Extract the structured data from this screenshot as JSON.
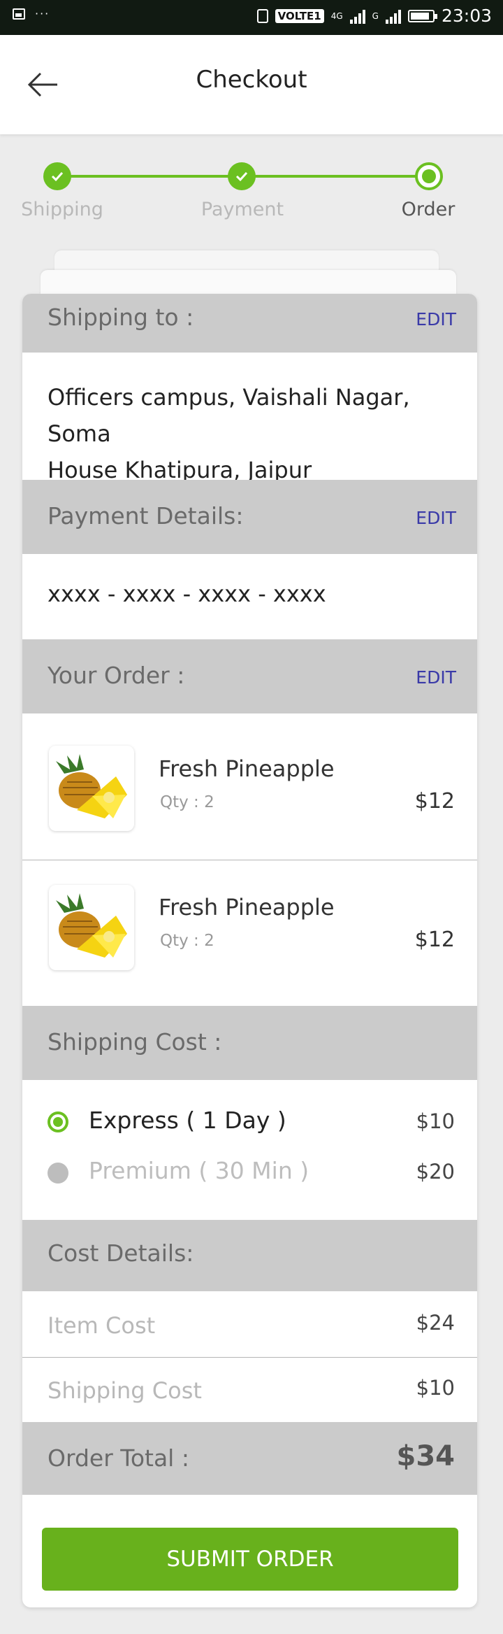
{
  "status_bar": {
    "network_badge": "VOLTE1",
    "sim1": "4G",
    "sim2": "G",
    "time": "23:03"
  },
  "header": {
    "title": "Checkout"
  },
  "stepper": {
    "steps": [
      {
        "label": "Shipping",
        "state": "complete"
      },
      {
        "label": "Payment",
        "state": "complete"
      },
      {
        "label": "Order",
        "state": "current"
      }
    ]
  },
  "shipping": {
    "heading": "Shipping to :",
    "edit": "EDIT",
    "address_line1": "Officers campus, Vaishali Nagar, Soma",
    "address_line2": "House Khatipura, Jaipur"
  },
  "payment": {
    "heading": "Payment Details:",
    "edit": "EDIT",
    "card_number": "xxxx - xxxx - xxxx - xxxx"
  },
  "order": {
    "heading": "Your Order :",
    "edit": "EDIT",
    "items": [
      {
        "name": "Fresh Pineapple",
        "qty": "Qty : 2",
        "price": "$12",
        "icon": "pineapple-image"
      },
      {
        "name": "Fresh Pineapple",
        "qty": "Qty : 2",
        "price": "$12",
        "icon": "pineapple-image"
      }
    ]
  },
  "shipping_cost": {
    "heading": "Shipping Cost :",
    "options": [
      {
        "label": "Express ( 1 Day )",
        "price": "$10",
        "selected": true
      },
      {
        "label": "Premium ( 30 Min )",
        "price": "$20",
        "selected": false
      }
    ]
  },
  "cost_details": {
    "heading": "Cost Details:",
    "item_cost_label": "Item Cost",
    "item_cost_value": "$24",
    "shipping_cost_label": "Shipping Cost",
    "shipping_cost_value": "$10",
    "total_label": "Order Total :",
    "total_value": "$34"
  },
  "submit_button": "SUBMIT ORDER",
  "colors": {
    "accent_green": "#6bc021",
    "button_green": "#68b11c",
    "section_header_gray": "#cbcbcb",
    "edit_link_blue": "#3a3aa8"
  }
}
